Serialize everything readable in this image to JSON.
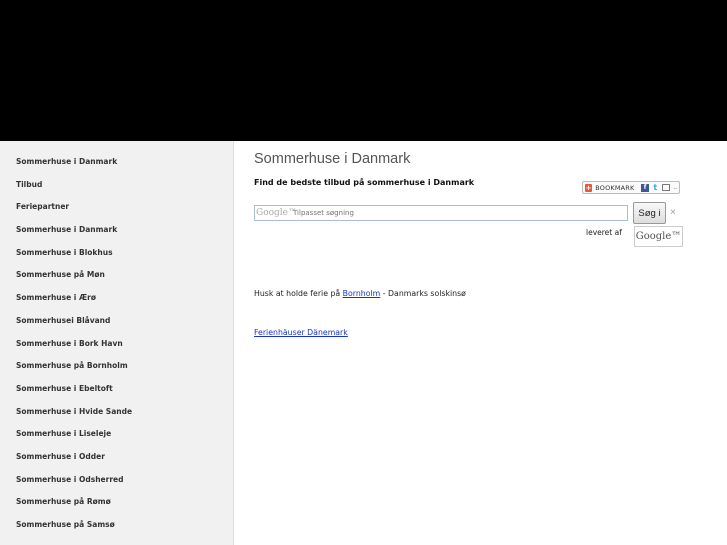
{
  "sidebar": {
    "items": [
      {
        "label": "Sommerhuse i Danmark"
      },
      {
        "label": "Tilbud"
      },
      {
        "label": "Feriepartner"
      },
      {
        "label": "Sommerhuse i Danmark"
      },
      {
        "label": "Sommerhuse i Blokhus"
      },
      {
        "label": "Sommerhuse på Møn"
      },
      {
        "label": "Sommerhuse i Ærø"
      },
      {
        "label": "Sommerhusei Blåvand"
      },
      {
        "label": "Sommerhuse i Bork Havn"
      },
      {
        "label": "Sommerhuse på Bornholm"
      },
      {
        "label": "Sommerhuse i Ebeltoft"
      },
      {
        "label": "Sommerhuse i Hvide Sande"
      },
      {
        "label": "Sommerhuse i Liseleje"
      },
      {
        "label": "Sommerhuse i Odder"
      },
      {
        "label": "Sommerhuse i Odsherred"
      },
      {
        "label": "Sommerhuse på Rømø"
      },
      {
        "label": "Sommerhuse på Samsø"
      }
    ]
  },
  "main": {
    "title": "Sommerhuse i Danmark",
    "subtitle": "Find de bedste tilbud på sommerhuse i Danmark",
    "bookmark_label": "BOOKMARK",
    "bookmark_more": "..",
    "search": {
      "google_mark": "Google™",
      "placeholder": "Tilpasset søgning",
      "button_label": "Søg i",
      "clear": "×",
      "powered_by": "leveret af",
      "google_logo": "Google™"
    },
    "ferie_text_before": "Husk at holde ferie på ",
    "ferie_link": "Bornholm",
    "ferie_text_after": " - Danmarks solskinsø",
    "ferien_link": "Ferienhäuser Dänemark"
  },
  "colors": {
    "banner": "#000000",
    "sidebar_bg": "#f1f1f1",
    "link": "#1a33cc"
  }
}
